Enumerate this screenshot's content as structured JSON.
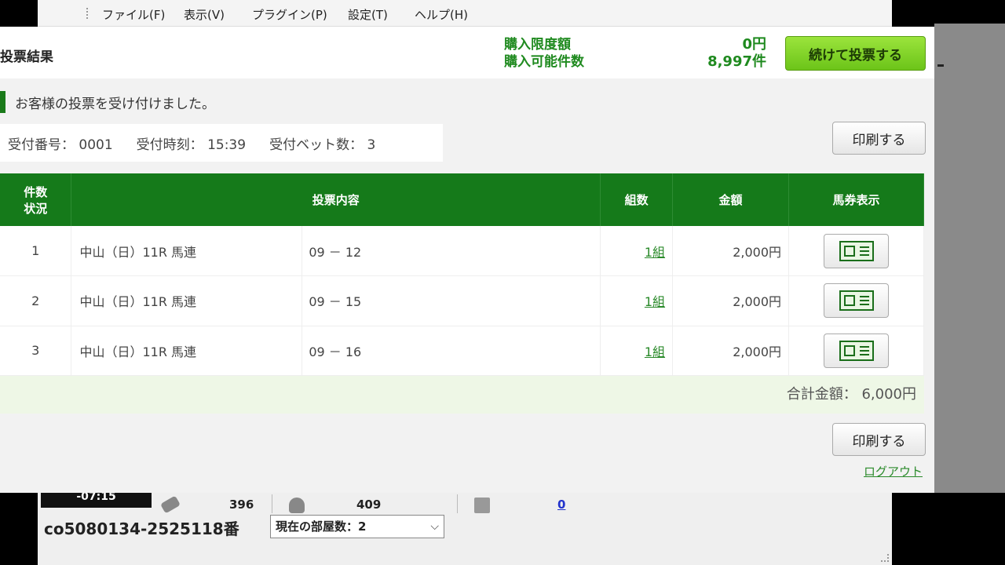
{
  "menu": {
    "items": [
      "ファイル(F)",
      "表示(V)",
      "プラグイン(P)",
      "設定(T)",
      "ヘルプ(H)"
    ]
  },
  "header": {
    "title": "投票結果",
    "limit_label": "購入限度額",
    "limit_value": "0円",
    "available_label": "購入可能件数",
    "available_value": "8,997件",
    "continue_button": "続けて投票する"
  },
  "notice": "お客様の投票を受け付けました。",
  "receipt": {
    "number": "受付番号： 0001",
    "time": "受付時刻： 15:39",
    "bets": "受付ベット数： 3"
  },
  "print_button": "印刷する",
  "table": {
    "headers": {
      "count_line1": "件数",
      "count_line2": "状況",
      "content": "投票内容",
      "kumi": "組数",
      "amount": "金額",
      "ticket": "馬券表示"
    },
    "rows": [
      {
        "no": "1",
        "race": "中山（日）11R 馬連",
        "combo": "09 － 12",
        "kumi": "1組",
        "amount": "2,000円"
      },
      {
        "no": "2",
        "race": "中山（日）11R 馬連",
        "combo": "09 － 15",
        "kumi": "1組",
        "amount": "2,000円"
      },
      {
        "no": "3",
        "race": "中山（日）11R 馬連",
        "combo": "09 － 16",
        "kumi": "1組",
        "amount": "2,000円"
      }
    ]
  },
  "total": "合計金額： 6,000円",
  "logout": "ログアウト",
  "broadcast": {
    "elapsed": "-07:15",
    "stat1": "396",
    "stat2": "409",
    "stat3": "0",
    "room_id": "co5080134-2525118番",
    "room_select": "現在の部屋数：2"
  },
  "colors": {
    "header_green": "#157a1a",
    "button_green": "#7fd22a",
    "link_green": "#2a8a2a"
  }
}
